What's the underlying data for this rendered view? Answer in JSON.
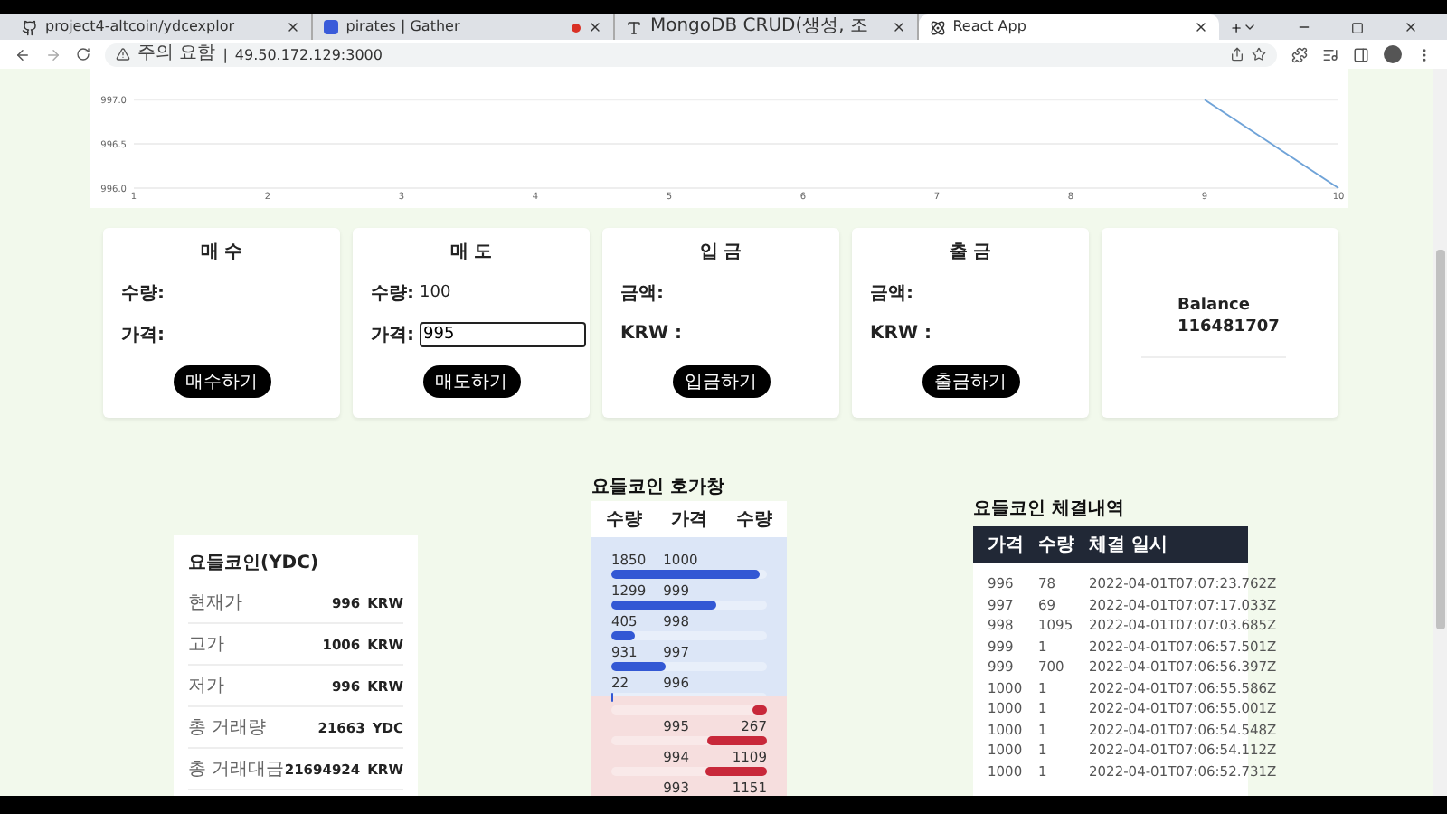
{
  "browser": {
    "tabs": [
      {
        "title": "project4-altcoin/ydcexplor",
        "selected": false,
        "recording": false
      },
      {
        "title": "pirates | Gather",
        "selected": false,
        "recording": true
      },
      {
        "title": "MongoDB CRUD(생성, 조",
        "selected": false,
        "recording": false
      },
      {
        "title": "React App",
        "selected": true,
        "recording": false
      }
    ],
    "address": {
      "warning": "주의 요함",
      "separator": "|",
      "url": "49.50.172.129:3000"
    }
  },
  "price_chart": {
    "chart_data": {
      "type": "line",
      "categories": [
        "1",
        "2",
        "3",
        "4",
        "5",
        "6",
        "7",
        "8",
        "9",
        "10"
      ],
      "series": [
        {
          "color": "#6fa3d8",
          "values": [
            null,
            null,
            null,
            null,
            null,
            null,
            null,
            null,
            997.0,
            996.0
          ]
        }
      ],
      "ylim": [
        996.0,
        997.35
      ],
      "yticks": [
        {
          "value": 996.0,
          "label": "996.0"
        },
        {
          "value": 996.5,
          "label": "996.5"
        },
        {
          "value": 997.0,
          "label": "997.0"
        }
      ]
    }
  },
  "trade_cards": [
    {
      "title": "매 수",
      "fields": [
        {
          "kind": "text",
          "label": "수량:"
        },
        {
          "kind": "text",
          "label": "가격:"
        }
      ],
      "button": "매수하기"
    },
    {
      "title": "매 도",
      "fields": [
        {
          "kind": "text",
          "label": "수량:",
          "value": "100"
        },
        {
          "kind": "input",
          "label": "가격:",
          "value": "995"
        }
      ],
      "button": "매도하기"
    },
    {
      "title": "입 금",
      "fields": [
        {
          "kind": "text",
          "label": "금액:"
        },
        {
          "kind": "text",
          "label": "KRW :"
        }
      ],
      "button": "입금하기"
    },
    {
      "title": "출 금",
      "fields": [
        {
          "kind": "text",
          "label": "금액:"
        },
        {
          "kind": "text",
          "label": "KRW :"
        }
      ],
      "button": "출금하기"
    }
  ],
  "balance": {
    "label": "Balance",
    "value": "116481707"
  },
  "coin_info": {
    "title": "요들코인(YDC)",
    "rows": [
      {
        "label": "현재가",
        "value": "996",
        "unit": "KRW"
      },
      {
        "label": "고가",
        "value": "1006",
        "unit": "KRW"
      },
      {
        "label": "저가",
        "value": "996",
        "unit": "KRW"
      },
      {
        "label": "총 거래량",
        "value": "21663",
        "unit": "YDC"
      },
      {
        "label": "총 거래대금",
        "value": "21694924",
        "unit": "KRW"
      }
    ]
  },
  "order_book": {
    "title": "요들코인 호가창",
    "columns": [
      "수량",
      "가격",
      "수량"
    ],
    "bids": [
      {
        "quantity": "1850",
        "price": "1000",
        "level": 0.95
      },
      {
        "quantity": "1299",
        "price": "999",
        "level": 0.67
      },
      {
        "quantity": "405",
        "price": "998",
        "level": 0.15
      },
      {
        "quantity": "931",
        "price": "997",
        "level": 0.35
      },
      {
        "quantity": "22",
        "price": "996",
        "level": 0.01
      }
    ],
    "asks": [
      {
        "price": "995",
        "quantity": "267",
        "level": 0.09
      },
      {
        "price": "994",
        "quantity": "1109",
        "level": 0.38
      },
      {
        "price": "993",
        "quantity": "1151",
        "level": 0.4
      }
    ]
  },
  "trade_history": {
    "title": "요들코인 체결내역",
    "columns": [
      "가격",
      "수량",
      "체결 일시"
    ],
    "rows": [
      [
        "996",
        "78",
        "2022-04-01T07:07:23.762Z"
      ],
      [
        "997",
        "69",
        "2022-04-01T07:07:17.033Z"
      ],
      [
        "998",
        "1095",
        "2022-04-01T07:07:03.685Z"
      ],
      [
        "999",
        "1",
        "2022-04-01T07:06:57.501Z"
      ],
      [
        "999",
        "700",
        "2022-04-01T07:06:56.397Z"
      ],
      [
        "1000",
        "1",
        "2022-04-01T07:06:55.586Z"
      ],
      [
        "1000",
        "1",
        "2022-04-01T07:06:55.001Z"
      ],
      [
        "1000",
        "1",
        "2022-04-01T07:06:54.548Z"
      ],
      [
        "1000",
        "1",
        "2022-04-01T07:06:54.112Z"
      ],
      [
        "1000",
        "1",
        "2022-04-01T07:06:52.731Z"
      ]
    ]
  }
}
